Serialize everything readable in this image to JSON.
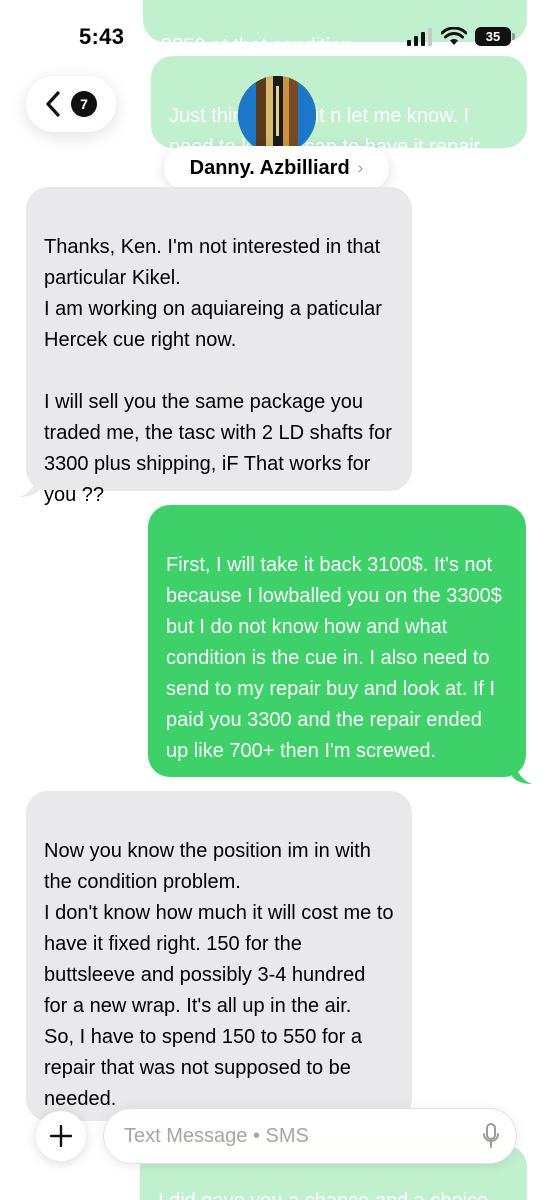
{
  "status_bar": {
    "time": "5:43",
    "battery_level": "35"
  },
  "header": {
    "back_badge_count": "7",
    "contact_name": "Danny. Azbilliard",
    "contact_chevron": "›"
  },
  "messages": [
    {
      "direction": "outgoing",
      "text": "3850 at that condition.",
      "partially_visible": true
    },
    {
      "direction": "outgoing",
      "text": "Just think about it n let me know. I need to know asap to have it repair",
      "partially_visible": true
    },
    {
      "direction": "incoming",
      "text": "Thanks, Ken. I'm not interested in that particular Kikel.\nI am working on aquiareing a paticular Hercek cue  right now.\n\nI will sell you the same package you traded me, the tasc with 2 LD shafts for 3300 plus shipping, iF That works for you ??"
    },
    {
      "direction": "outgoing",
      "text": "First, I will take it back 3100$. It's not because I lowballed you on the 3300$ but I do not know how and what condition is the cue in. I also need to send to my repair buy and look at. If I paid you 3300 and the repair ended up like 700+ then I'm screwed."
    },
    {
      "direction": "incoming",
      "text": "Now you know the position im in with the condition problem.\nI don't know how much it will cost me to have it fixed right. 150 for the buttsleeve and possibly 3-4 hundred for a new wrap. It's all up in the air.\nSo, I have to spend 150 to 550 for a repair that was not supposed to be needed."
    },
    {
      "direction": "outgoing",
      "text": "I did gave you a chance and a choice to send it back to me",
      "partially_visible": true
    }
  ],
  "compose": {
    "placeholder": "Text Message • SMS"
  },
  "icons": {
    "back": "chevron-left-icon",
    "signal": "cellular-signal-icon",
    "wifi": "wifi-icon",
    "battery": "battery-icon",
    "add": "plus-icon",
    "mic": "microphone-icon"
  },
  "colors": {
    "outgoing_bubble": "#3ed16a",
    "incoming_bubble": "#e9e9eb"
  }
}
